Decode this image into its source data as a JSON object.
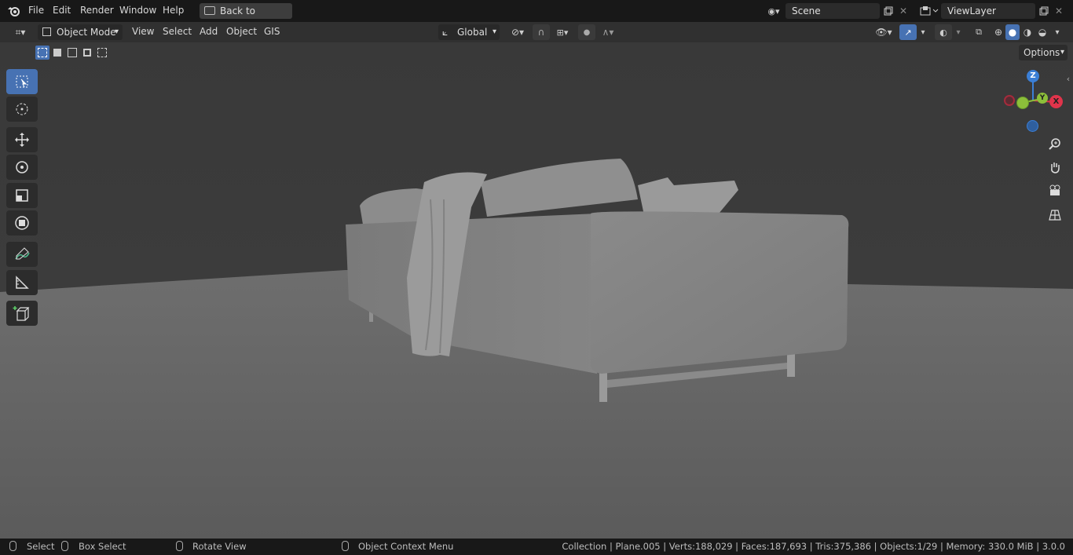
{
  "topbar": {
    "menus": [
      "File",
      "Edit",
      "Render",
      "Window",
      "Help"
    ],
    "back_button": "Back to Previous",
    "scene": "Scene",
    "view_layer": "ViewLayer"
  },
  "header": {
    "mode": "Object Mode",
    "menus": [
      "View",
      "Select",
      "Add",
      "Object",
      "GIS"
    ],
    "transform_orientation": "Global",
    "options_label": "Options"
  },
  "gizmo": {
    "z": "Z",
    "y": "Y",
    "x": "X"
  },
  "status": {
    "select": "Select",
    "box_select": "Box Select",
    "rotate_view": "Rotate View",
    "context_menu": "Object Context Menu",
    "stats": "Collection | Plane.005 | Verts:188,029 | Faces:187,693 | Tris:375,386 | Objects:1/29 | Memory: 330.0 MiB | 3.0.0"
  },
  "colors": {
    "accent": "#4772b3",
    "x_axis": "#e0344b",
    "y_axis": "#8cbf3a",
    "z_axis": "#3b7fd6"
  }
}
